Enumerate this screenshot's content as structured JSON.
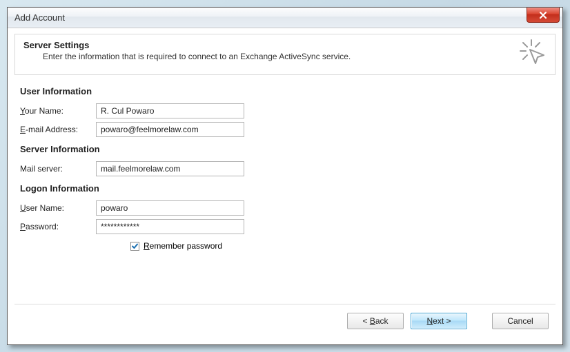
{
  "window": {
    "title": "Add Account"
  },
  "header": {
    "title": "Server Settings",
    "description": "Enter the information that is required to connect to an Exchange ActiveSync service."
  },
  "sections": {
    "user_info": "User Information",
    "server_info": "Server Information",
    "logon_info": "Logon Information"
  },
  "labels": {
    "your_name_pre": "Y",
    "your_name_rest": "our Name:",
    "email_pre": "E",
    "email_rest": "-mail Address:",
    "mail_server": "Mail server:",
    "user_name_pre": "U",
    "user_name_rest": "ser Name:",
    "password_pre": "P",
    "password_rest": "assword:",
    "remember_pre": "R",
    "remember_rest": "emember password"
  },
  "values": {
    "your_name": "R. Cul Powaro",
    "email": "powaro@feelmorelaw.com",
    "mail_server": "mail.feelmorelaw.com",
    "user_name": "powaro",
    "password": "************"
  },
  "remember_checked": true,
  "buttons": {
    "back_lt": "< ",
    "back_u": "B",
    "back_rest": "ack",
    "next_u": "N",
    "next_rest": "ext >",
    "cancel": "Cancel"
  }
}
